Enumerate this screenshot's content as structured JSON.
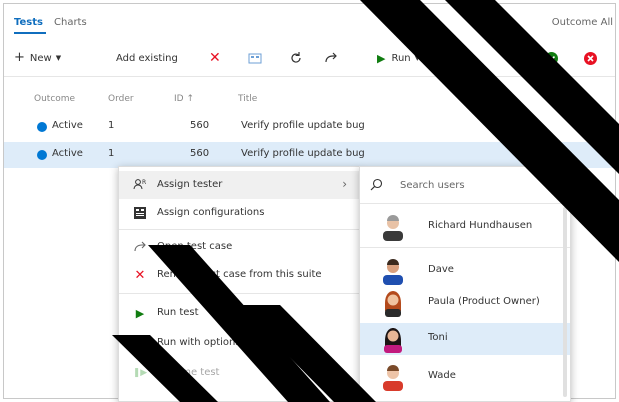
{
  "tabs": [
    "Tests",
    "Charts"
  ],
  "header_right": "Outcome All",
  "toolbar": {
    "new_label": "New",
    "add_existing_label": "Add existing",
    "run_label": "Run"
  },
  "columns": [
    "Outcome",
    "Order",
    "ID ↑",
    "Title"
  ],
  "rows": [
    {
      "outcome": "Active",
      "order": "1",
      "id": "560",
      "title": "Verify profile update bug"
    },
    {
      "outcome": "Active",
      "order": "1",
      "id": "560",
      "title": "Verify profile update bug"
    }
  ],
  "context_menu": {
    "items": [
      {
        "label": "Assign tester",
        "icon": "assign-tester-icon"
      },
      {
        "label": "Assign configurations",
        "icon": "configurations-icon"
      },
      {
        "label": "Open test case",
        "icon": "open-test-case-icon"
      },
      {
        "label": "Remove test case from this suite",
        "icon": "remove-icon"
      },
      {
        "label": "Run test",
        "icon": "play-icon"
      },
      {
        "label": "Run with options",
        "icon": "play-icon"
      },
      {
        "label": "Resume test",
        "icon": "resume-icon"
      }
    ]
  },
  "tester_submenu": {
    "search_placeholder": "Search users",
    "users": [
      "Richard Hundhausen",
      "Dave",
      "Paula (Product Owner)",
      "Toni",
      "Wade"
    ]
  },
  "colors": {
    "accent": "#106ebe",
    "active_dot": "#0078d4",
    "selection": "#deecf9",
    "run_green": "#107c10",
    "delete_red": "#e81123"
  }
}
